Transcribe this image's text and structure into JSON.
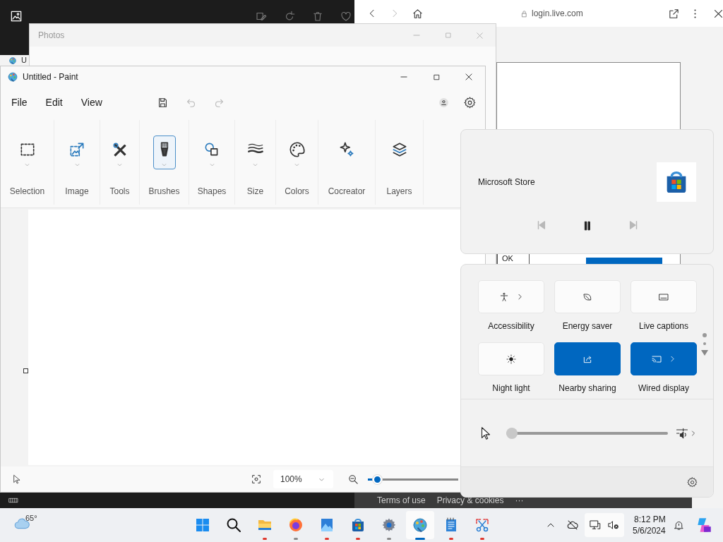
{
  "photos": {
    "title": "Photos"
  },
  "hidden_window": {
    "title": "U"
  },
  "browser": {
    "forward_disabled": true,
    "address": "login.live.com",
    "dialog_button": "OK",
    "footer_links": [
      "Terms of use",
      "Privacy & cookies",
      "···"
    ]
  },
  "paint": {
    "title": "Untitled - Paint",
    "menu": [
      "File",
      "Edit",
      "View"
    ],
    "undo_disabled": true,
    "redo_disabled": true,
    "ribbon": [
      {
        "label": "Selection",
        "dropdown": true,
        "selected": false
      },
      {
        "label": "Image",
        "dropdown": true,
        "selected": false
      },
      {
        "label": "Tools",
        "dropdown": true,
        "selected": false
      },
      {
        "label": "Brushes",
        "dropdown": true,
        "selected": true
      },
      {
        "label": "Shapes",
        "dropdown": true,
        "selected": false
      },
      {
        "label": "Size",
        "dropdown": true,
        "selected": false
      },
      {
        "label": "Colors",
        "dropdown": true,
        "selected": false
      },
      {
        "label": "Cocreator",
        "dropdown": false,
        "selected": false
      },
      {
        "label": "Layers",
        "dropdown": false,
        "selected": false
      }
    ],
    "zoom": {
      "value": "100%",
      "level": 0.1
    }
  },
  "media": {
    "app": "Microsoft Store",
    "previous_disabled": true,
    "next_disabled": true
  },
  "quick_settings": {
    "tiles": [
      {
        "label": "Accessibility",
        "on": false,
        "chevron": true
      },
      {
        "label": "Energy saver",
        "on": false,
        "chevron": false
      },
      {
        "label": "Live captions",
        "on": false,
        "chevron": false
      },
      {
        "label": "Night light",
        "on": false,
        "chevron": false
      },
      {
        "label": "Nearby sharing",
        "on": true,
        "chevron": false
      },
      {
        "label": "Wired display",
        "on": true,
        "chevron": true
      }
    ],
    "volume": {
      "level": 0
    }
  },
  "taskbar": {
    "weather": "65°",
    "apps": [
      {
        "selected": false
      },
      {
        "selected": false
      },
      {
        "selected": false,
        "color": "#e0382e"
      },
      {
        "selected": false,
        "color": "#8a8a8a"
      },
      {
        "selected": false,
        "color": "#e0382e"
      },
      {
        "selected": false,
        "color": "#e0382e"
      },
      {
        "selected": false,
        "color": "#8a8a8a"
      },
      {
        "selected": true,
        "color": "#0067c0"
      },
      {
        "selected": false,
        "color": "#e0382e"
      },
      {
        "selected": false,
        "color": "#e0382e"
      }
    ],
    "clock": {
      "time": "8:12 PM",
      "date": "5/6/2024"
    }
  }
}
